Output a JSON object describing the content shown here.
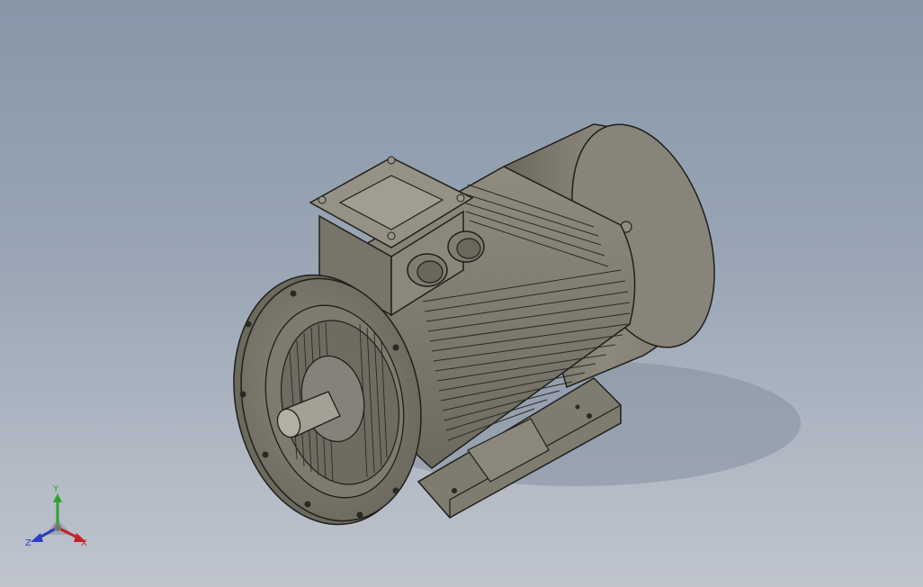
{
  "scene": {
    "background_top": "#8796a8",
    "background_bottom": "#bfc4cd",
    "model_fill": "#8a877a",
    "model_dark": "#5e5b52",
    "model_light": "#a7a496",
    "edge_color": "#1f1f1c"
  },
  "triad": {
    "y_label": "Y",
    "x_label": "X",
    "z_label": "Z",
    "y_color": "#2fa12f",
    "x_color": "#c42323",
    "z_color": "#2840c4"
  }
}
